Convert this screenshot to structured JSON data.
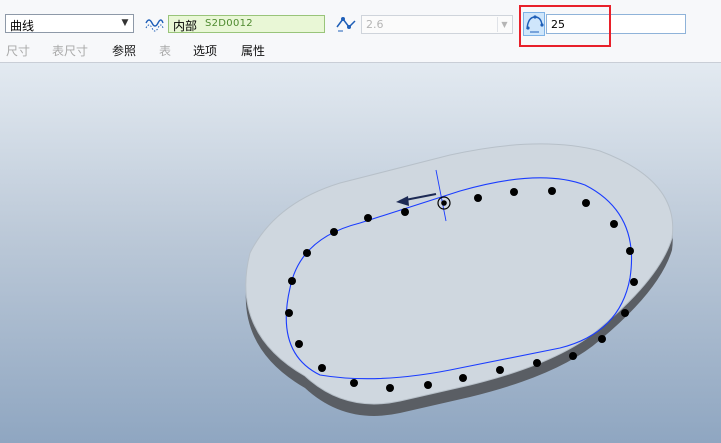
{
  "toolbar": {
    "type_select": {
      "value": "曲线"
    },
    "reference": {
      "label": "内部",
      "name": "S2D0012"
    },
    "value_select": {
      "value": "2.6"
    },
    "pitch_input": {
      "value": "25"
    }
  },
  "tabs": [
    {
      "label": "尺寸",
      "enabled": false
    },
    {
      "label": "表尺寸",
      "enabled": false
    },
    {
      "label": "参照",
      "enabled": true
    },
    {
      "label": "表",
      "enabled": false
    },
    {
      "label": "选项",
      "enabled": true
    },
    {
      "label": "属性",
      "enabled": true
    }
  ],
  "colors": {
    "highlight": "#e8202a",
    "curve": "#1a3cff",
    "part_face": "#cfd8e0",
    "part_side": "#55585e",
    "point": "#000000"
  },
  "icons": {
    "type_select_arrow": "chevron-down-icon",
    "curve_icon": "wave-curve-icon",
    "value_icon": "pattern-spacing-icon",
    "pitch_icon": "pattern-pitch-icon"
  },
  "pattern": {
    "point_count": 25
  }
}
